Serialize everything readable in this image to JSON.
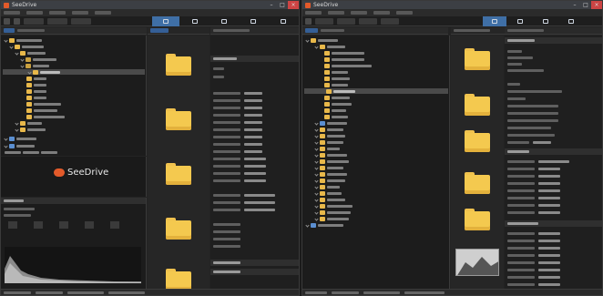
{
  "left_window": {
    "title": "SeeDrive",
    "folder_captions": [
      "",
      "",
      "",
      "",
      ""
    ]
  },
  "right_window": {
    "title": "SeeDrive",
    "folder_captions": [
      "",
      "",
      "",
      "",
      ""
    ],
    "image_caption": ""
  },
  "seedrive_promo": {
    "logo_text": "SeeDrive",
    "tagline": ""
  },
  "colors": {
    "accent_blue": "#3f6fa6",
    "folder_yellow": "#f4c94f",
    "close_red": "#c44444",
    "brand_orange": "#e35a2a"
  },
  "icons": [
    "app-icon",
    "folder-icon",
    "minimize-icon",
    "maximize-icon",
    "close-icon",
    "histogram-icon",
    "cloud-icon"
  ]
}
